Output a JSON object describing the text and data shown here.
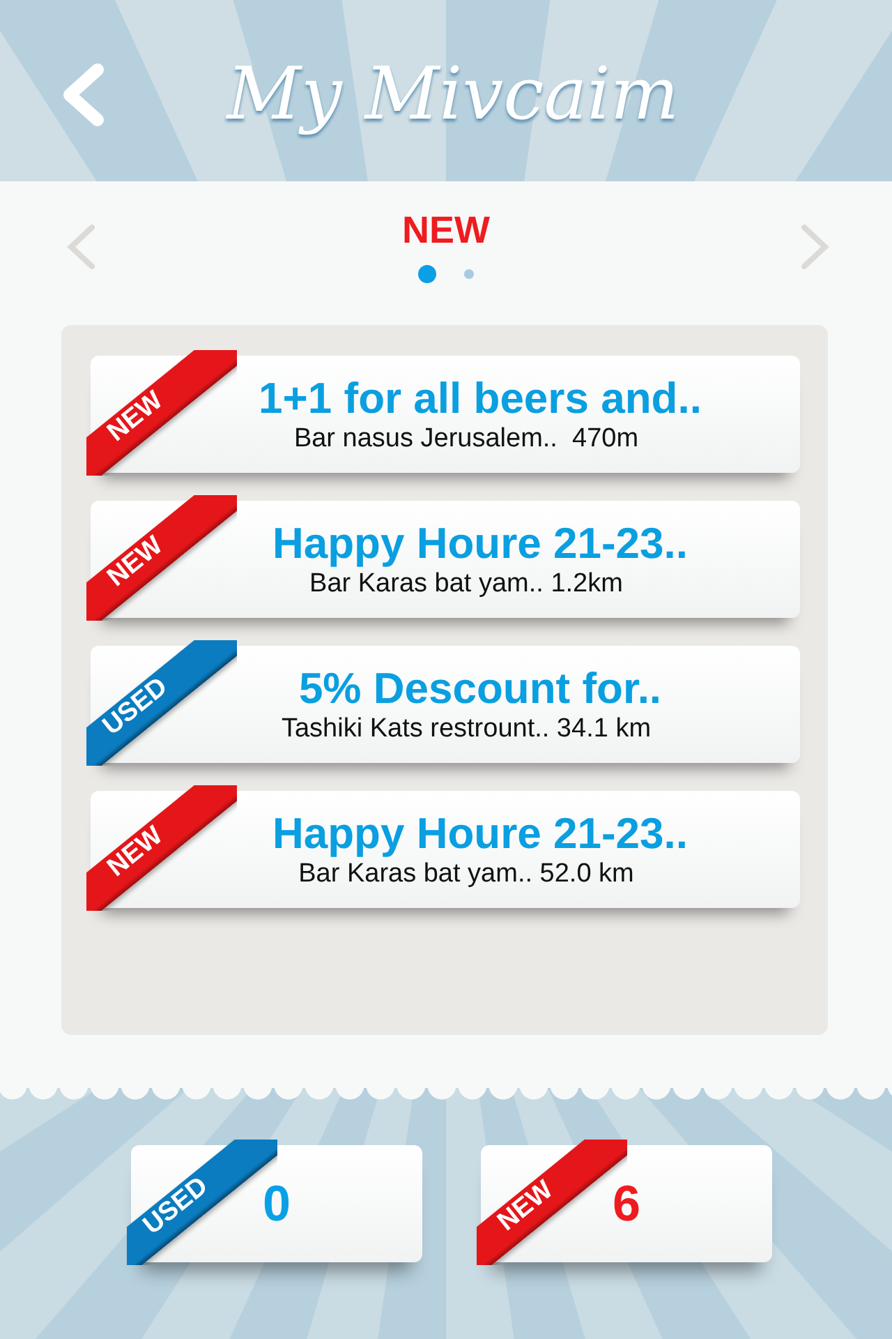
{
  "header": {
    "title": "My Mivcaim"
  },
  "pager": {
    "title": "NEW",
    "pages": [
      {
        "selected": true
      },
      {
        "selected": false
      }
    ]
  },
  "deals": [
    {
      "tag": "NEW",
      "kind": "new",
      "title": "1+1 for all beers and..",
      "details": "Bar nasus Jerusalem..  470m"
    },
    {
      "tag": "NEW",
      "kind": "new",
      "title": "Happy Houre 21-23..",
      "details": "Bar Karas bat yam.. 1.2km"
    },
    {
      "tag": "USED",
      "kind": "used",
      "title": "5% Descount for..",
      "details": "Tashiki Kats restrount.. 34.1 km"
    },
    {
      "tag": "NEW",
      "kind": "new",
      "title": "Happy Houre 21-23..",
      "details": "Bar Karas bat yam.. 52.0 km"
    }
  ],
  "summary": [
    {
      "tag": "USED",
      "kind": "used",
      "count": "0"
    },
    {
      "tag": "NEW",
      "kind": "new",
      "count": "6"
    }
  ]
}
